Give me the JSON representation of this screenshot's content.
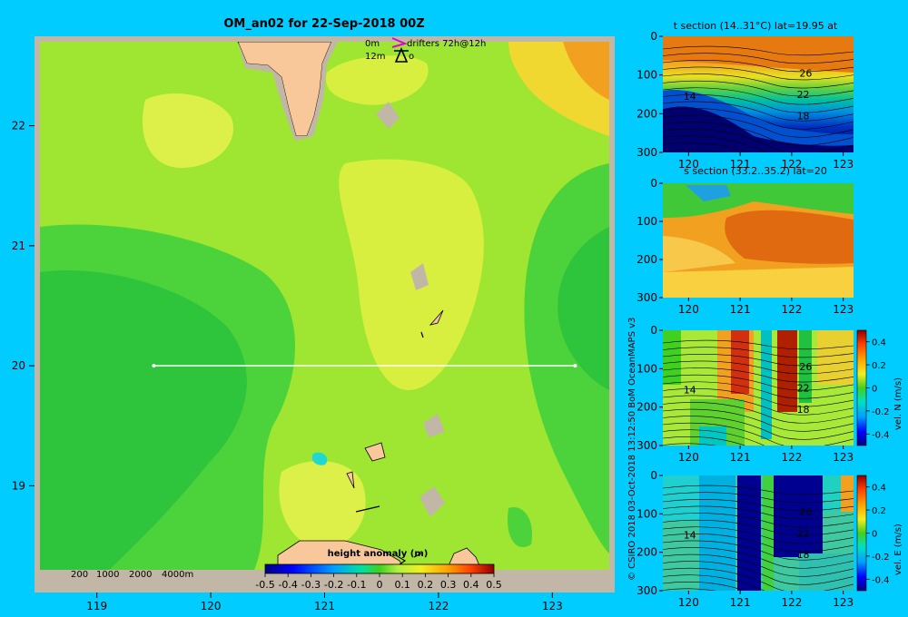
{
  "title": "OM_an02 for 22-Sep-2018 00Z",
  "credit": "© CSIRO 2018   03-Oct-2018 13:12:50 BoM OceanMAPS v3",
  "drifter_legend": {
    "line1_depth": "0m",
    "line1_text": "drifters 72h@12h",
    "line2_depth": "12m",
    "line2_text": "o"
  },
  "bathy_legend": [
    "200",
    "1000",
    "2000",
    "4000m"
  ],
  "colors": {
    "background": "#00ccff",
    "frame": "#c2b7a6",
    "land": "#f8c89a",
    "transect": "#ffffff",
    "drifter_marker": "#e000e0"
  },
  "chart_data": [
    {
      "type": "heatmap",
      "name": "main-map",
      "xlim": [
        118.5,
        123.5
      ],
      "ylim": [
        18.3,
        22.7
      ],
      "xticks": [
        119,
        120,
        121,
        122,
        123
      ],
      "yticks": [
        19,
        20,
        21,
        22
      ],
      "transect": {
        "lat": 20,
        "lon_start": 119.5,
        "lon_end": 123.2
      },
      "colorbar": {
        "title": "height anomaly (m)",
        "ticks": [
          "-0.5",
          "-0.4",
          "-0.3",
          "-0.2",
          "-0.1",
          "0",
          "0.1",
          "0.2",
          "0.3",
          "0.4",
          "0.5"
        ],
        "range": [
          -0.5,
          0.5
        ]
      }
    },
    {
      "type": "heatmap",
      "name": "t-section",
      "title": "t section (14..31°C) lat=19.95 at",
      "xlim": [
        119.5,
        123.2
      ],
      "ylim": [
        300,
        0
      ],
      "xticks": [
        "120",
        "121",
        "122",
        "123"
      ],
      "yticks": [
        "0",
        "100",
        "200",
        "300"
      ],
      "contour_labels": [
        {
          "text": "26",
          "lon": 122.15,
          "depth": 95
        },
        {
          "text": "22",
          "lon": 122.1,
          "depth": 150
        },
        {
          "text": "18",
          "lon": 122.1,
          "depth": 205
        },
        {
          "text": "14",
          "lon": 119.9,
          "depth": 155
        }
      ]
    },
    {
      "type": "heatmap",
      "name": "s-section",
      "title": "s section (33.2..35.2) lat=20",
      "xlim": [
        119.5,
        123.2
      ],
      "ylim": [
        300,
        0
      ],
      "xticks": [
        "120",
        "121",
        "122",
        "123"
      ],
      "yticks": [
        "0",
        "100",
        "200",
        "300"
      ]
    },
    {
      "type": "heatmap",
      "name": "vel-n-section",
      "ylabel": "vel. N (m/s)",
      "xlim": [
        119.5,
        123.2
      ],
      "ylim": [
        300,
        0
      ],
      "xticks": [
        "120",
        "121",
        "122",
        "123"
      ],
      "yticks": [
        "0",
        "100",
        "200",
        "300"
      ],
      "colorbar_ticks": [
        "0.4",
        "0.2",
        "0",
        "-0.2",
        "-0.4"
      ],
      "contour_labels": [
        {
          "text": "26",
          "lon": 122.15,
          "depth": 95
        },
        {
          "text": "22",
          "lon": 122.1,
          "depth": 150
        },
        {
          "text": "18",
          "lon": 122.1,
          "depth": 205
        },
        {
          "text": "14",
          "lon": 119.9,
          "depth": 155
        }
      ]
    },
    {
      "type": "heatmap",
      "name": "vel-e-section",
      "ylabel": "vel. E (m/s)",
      "xlim": [
        119.5,
        123.2
      ],
      "ylim": [
        300,
        0
      ],
      "xticks": [
        "120",
        "121",
        "122",
        "123"
      ],
      "yticks": [
        "0",
        "100",
        "200",
        "300"
      ],
      "colorbar_ticks": [
        "0.4",
        "0.2",
        "0",
        "-0.2",
        "-0.4"
      ],
      "contour_labels": [
        {
          "text": "26",
          "lon": 122.15,
          "depth": 95
        },
        {
          "text": "22",
          "lon": 122.1,
          "depth": 150
        },
        {
          "text": "18",
          "lon": 122.1,
          "depth": 205
        },
        {
          "text": "14",
          "lon": 119.9,
          "depth": 155
        }
      ]
    }
  ]
}
